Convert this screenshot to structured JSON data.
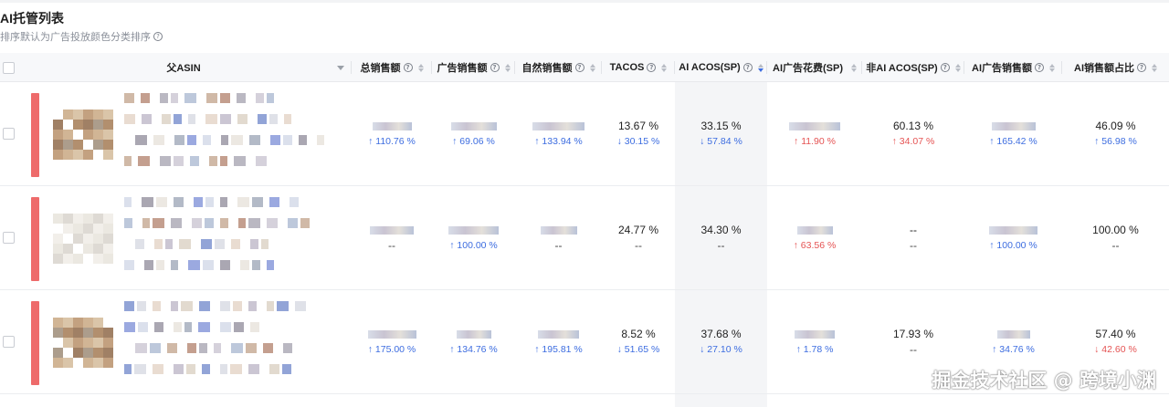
{
  "header": {
    "title": "AI托管列表",
    "subtitle": "排序默认为广告投放颜色分类排序"
  },
  "colors": {
    "accent": "#3d6de0",
    "negative": "#e55353",
    "row_marker": "#ee6b6b",
    "highlight_column_bg": "#f4f5f7"
  },
  "columns": [
    {
      "label": "父ASIN",
      "help": false,
      "sort": false,
      "filter": true
    },
    {
      "label": "总销售额",
      "help": true,
      "sort": true
    },
    {
      "label": "广告销售额",
      "help": true,
      "sort": true
    },
    {
      "label": "自然销售额",
      "help": true,
      "sort": true
    },
    {
      "label": "TACOS",
      "help": true,
      "sort": true
    },
    {
      "label": "AI ACOS(SP)",
      "help": true,
      "sort": true,
      "sort_state": "desc"
    },
    {
      "label": "AI广告花费(SP)",
      "help": false,
      "sort": true
    },
    {
      "label": "非AI ACOS(SP)",
      "help": true,
      "sort": true
    },
    {
      "label": "AI广告销售额",
      "help": true,
      "sort": true
    },
    {
      "label": "AI销售额占比",
      "help": true,
      "sort": true
    }
  ],
  "rows": [
    {
      "total_sales": {
        "value": "",
        "delta": "↑ 110.76 %",
        "dir": "up"
      },
      "ad_sales": {
        "value": "",
        "delta": "↑ 69.06 %",
        "dir": "up"
      },
      "organic_sales": {
        "value": "",
        "delta": "↑ 133.94 %",
        "dir": "up"
      },
      "tacos": {
        "value": "13.67 %",
        "delta": "↓ 30.15 %",
        "dir": "down-blue"
      },
      "ai_acos": {
        "value": "33.15 %",
        "delta": "↓ 57.84 %",
        "dir": "down-blue"
      },
      "ai_spend": {
        "value": "",
        "delta": "↑ 11.90 %",
        "dir": "up-red"
      },
      "non_ai_acos": {
        "value": "60.13 %",
        "delta": "↑ 34.07 %",
        "dir": "up-red"
      },
      "ai_ad_sales": {
        "value": "",
        "delta": "↑ 165.42 %",
        "dir": "up"
      },
      "ai_sales_ratio": {
        "value": "46.09 %",
        "delta": "↑ 56.98 %",
        "dir": "up"
      }
    },
    {
      "total_sales": {
        "value": "",
        "delta": "--",
        "dir": "none"
      },
      "ad_sales": {
        "value": "",
        "delta": "↑ 100.00 %",
        "dir": "up"
      },
      "organic_sales": {
        "value": "",
        "delta": "--",
        "dir": "none"
      },
      "tacos": {
        "value": "24.77 %",
        "delta": "--",
        "dir": "none"
      },
      "ai_acos": {
        "value": "34.30 %",
        "delta": "--",
        "dir": "none"
      },
      "ai_spend": {
        "value": "",
        "delta": "↑ 63.56 %",
        "dir": "up-red"
      },
      "non_ai_acos": {
        "value": "--",
        "delta": "--",
        "dir": "none"
      },
      "ai_ad_sales": {
        "value": "",
        "delta": "↑ 100.00 %",
        "dir": "up"
      },
      "ai_sales_ratio": {
        "value": "100.00 %",
        "delta": "--",
        "dir": "none"
      }
    },
    {
      "total_sales": {
        "value": "",
        "delta": "↑ 175.00 %",
        "dir": "up"
      },
      "ad_sales": {
        "value": "",
        "delta": "↑ 134.76 %",
        "dir": "up"
      },
      "organic_sales": {
        "value": "",
        "delta": "↑ 195.81 %",
        "dir": "up"
      },
      "tacos": {
        "value": "8.52 %",
        "delta": "↓ 51.65 %",
        "dir": "down-blue"
      },
      "ai_acos": {
        "value": "37.68 %",
        "delta": "↓ 27.10 %",
        "dir": "down-blue"
      },
      "ai_spend": {
        "value": "",
        "delta": "↑ 1.78 %",
        "dir": "up"
      },
      "non_ai_acos": {
        "value": "17.93 %",
        "delta": "--",
        "dir": "none"
      },
      "ai_ad_sales": {
        "value": "",
        "delta": "↑ 34.76 %",
        "dir": "up"
      },
      "ai_sales_ratio": {
        "value": "57.40 %",
        "delta": "↓ 42.60 %",
        "dir": "down-red"
      }
    }
  ],
  "watermark": "掘金技术社区 @ 跨境小渊"
}
